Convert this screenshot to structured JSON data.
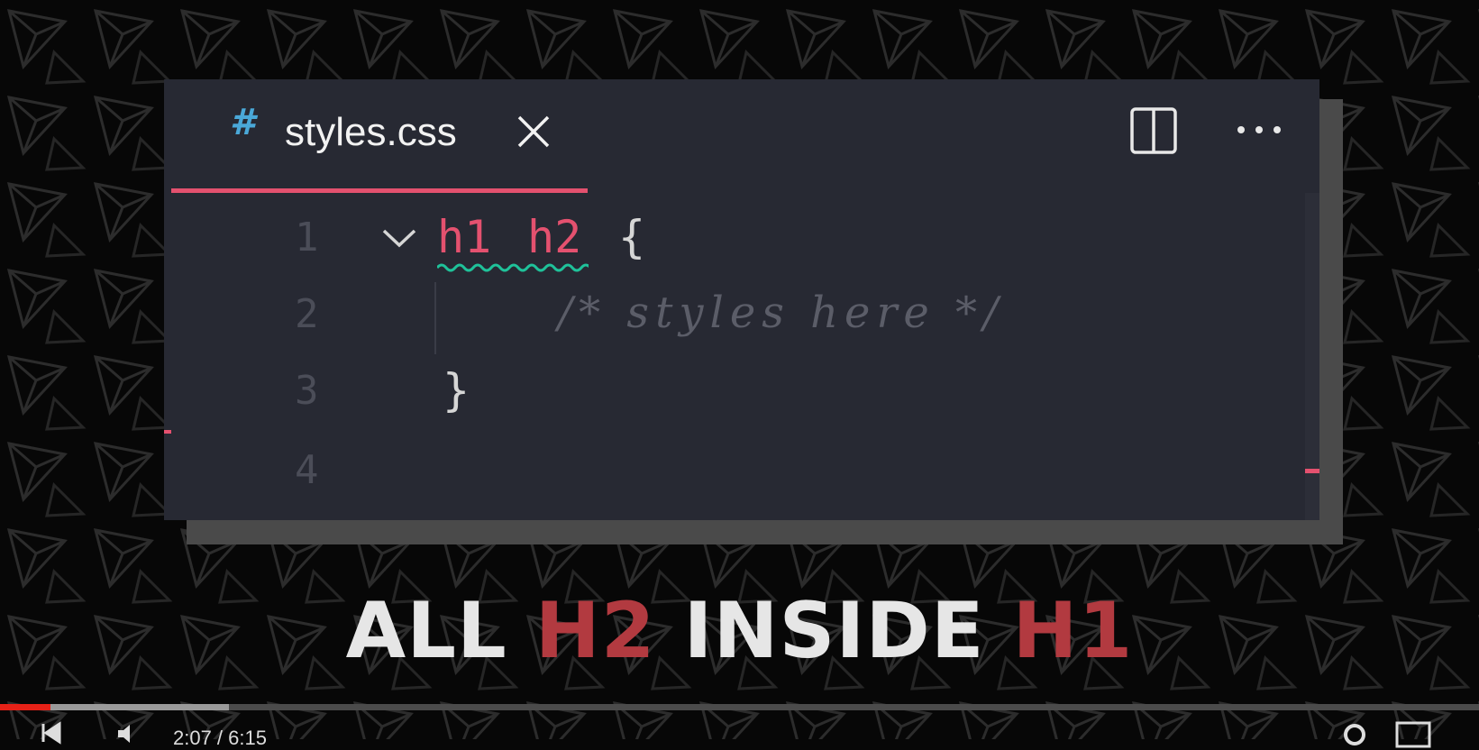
{
  "editor": {
    "tab": {
      "icon": "#",
      "label": "styles.css",
      "close_icon": "close-icon"
    },
    "actions": {
      "split_icon": "split-editor-icon",
      "more_icon": "more-actions-icon"
    },
    "lines": [
      {
        "number": "1",
        "selector_a": "h1",
        "selector_b": "h2",
        "brace": "{"
      },
      {
        "number": "2",
        "comment": "/* styles here */"
      },
      {
        "number": "3",
        "brace": "}"
      },
      {
        "number": "4"
      }
    ]
  },
  "caption": {
    "part1": "ALL ",
    "part2": "H2",
    "part3": " INSIDE ",
    "part4": "H1"
  },
  "player": {
    "time": "2:07 / 6:15",
    "played_fraction": 0.034,
    "buffered_fraction": 0.155,
    "colors": {
      "played": "#e62117",
      "accent": "#e4516f"
    }
  }
}
